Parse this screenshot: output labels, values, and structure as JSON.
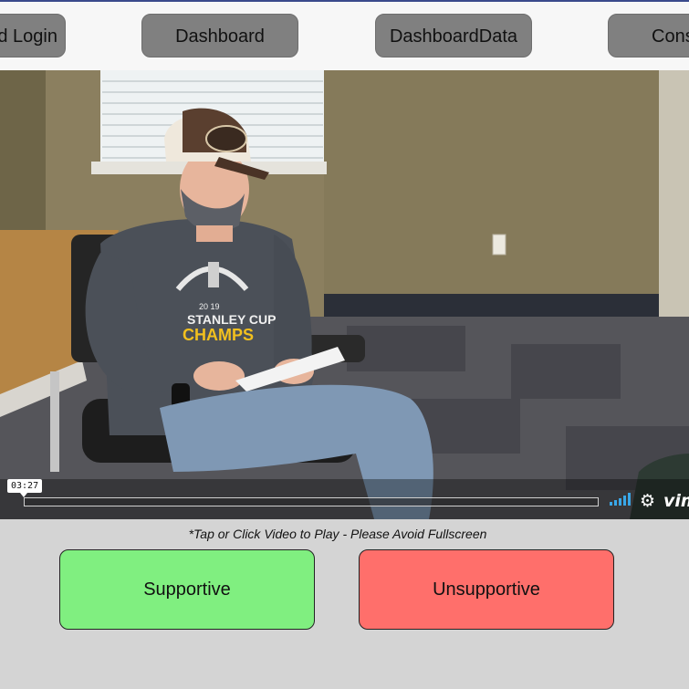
{
  "nav": {
    "buttons": [
      {
        "label": "d Login"
      },
      {
        "label": "Dashboard"
      },
      {
        "label": "DashboardData"
      },
      {
        "label": "Cons"
      }
    ]
  },
  "video": {
    "timestamp": "03:27",
    "player_logo": "vim",
    "icons": [
      "volume-icon",
      "gear-icon"
    ],
    "shirt_text_top": "STANLEY CUP",
    "shirt_text_bottom": "CHAMPS",
    "shirt_year": "20  19"
  },
  "instruction": "*Tap or Click Video to Play - Please Avoid Fullscreen",
  "choices": {
    "supportive_label": "Supportive",
    "unsupportive_label": "Unsupportive"
  },
  "colors": {
    "supportive": "#80ef80",
    "unsupportive": "#ff6f6b",
    "nav_button": "#808080"
  }
}
